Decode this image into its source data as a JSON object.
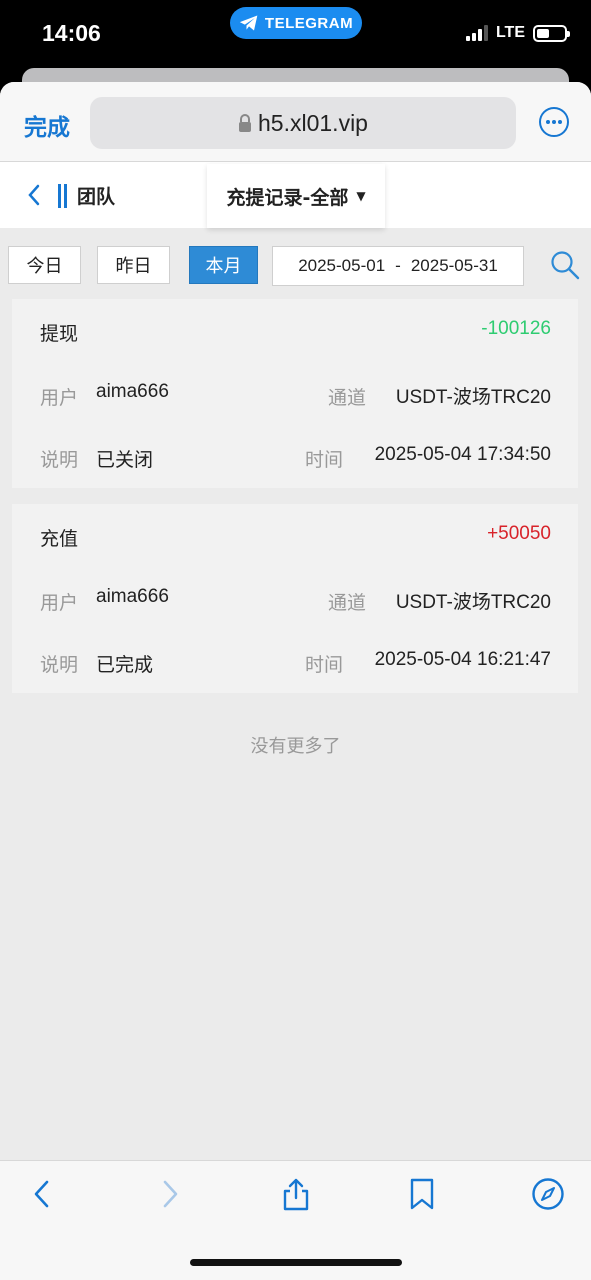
{
  "status_bar": {
    "time": "14:06",
    "app_pill": "TELEGRAM",
    "network": "LTE"
  },
  "browser": {
    "done_label": "完成",
    "url": "h5.xl01.vip"
  },
  "nav": {
    "team_label": "团队",
    "title": "充提记录-全部"
  },
  "filter": {
    "today": "今日",
    "yesterday": "昨日",
    "this_month": "本月",
    "active": "本月",
    "start_date": "2025-05-01",
    "separator": "-",
    "end_date": "2025-05-31"
  },
  "labels": {
    "user": "用户",
    "channel": "通道",
    "note": "说明",
    "time": "时间"
  },
  "records": [
    {
      "type": "提现",
      "amount": "-100126",
      "amount_color": "#2ecc71",
      "user": "aima666",
      "channel": "USDT-波场TRC20",
      "note": "已关闭",
      "time": "2025-05-04 17:34:50"
    },
    {
      "type": "充值",
      "amount": "+50050",
      "amount_color": "#d8232a",
      "user": "aima666",
      "channel": "USDT-波场TRC20",
      "note": "已完成",
      "time": "2025-05-04 16:21:47"
    }
  ],
  "end_of_list": "没有更多了",
  "colors": {
    "accent": "#1677d2",
    "active_tab": "#2e8bd6"
  }
}
